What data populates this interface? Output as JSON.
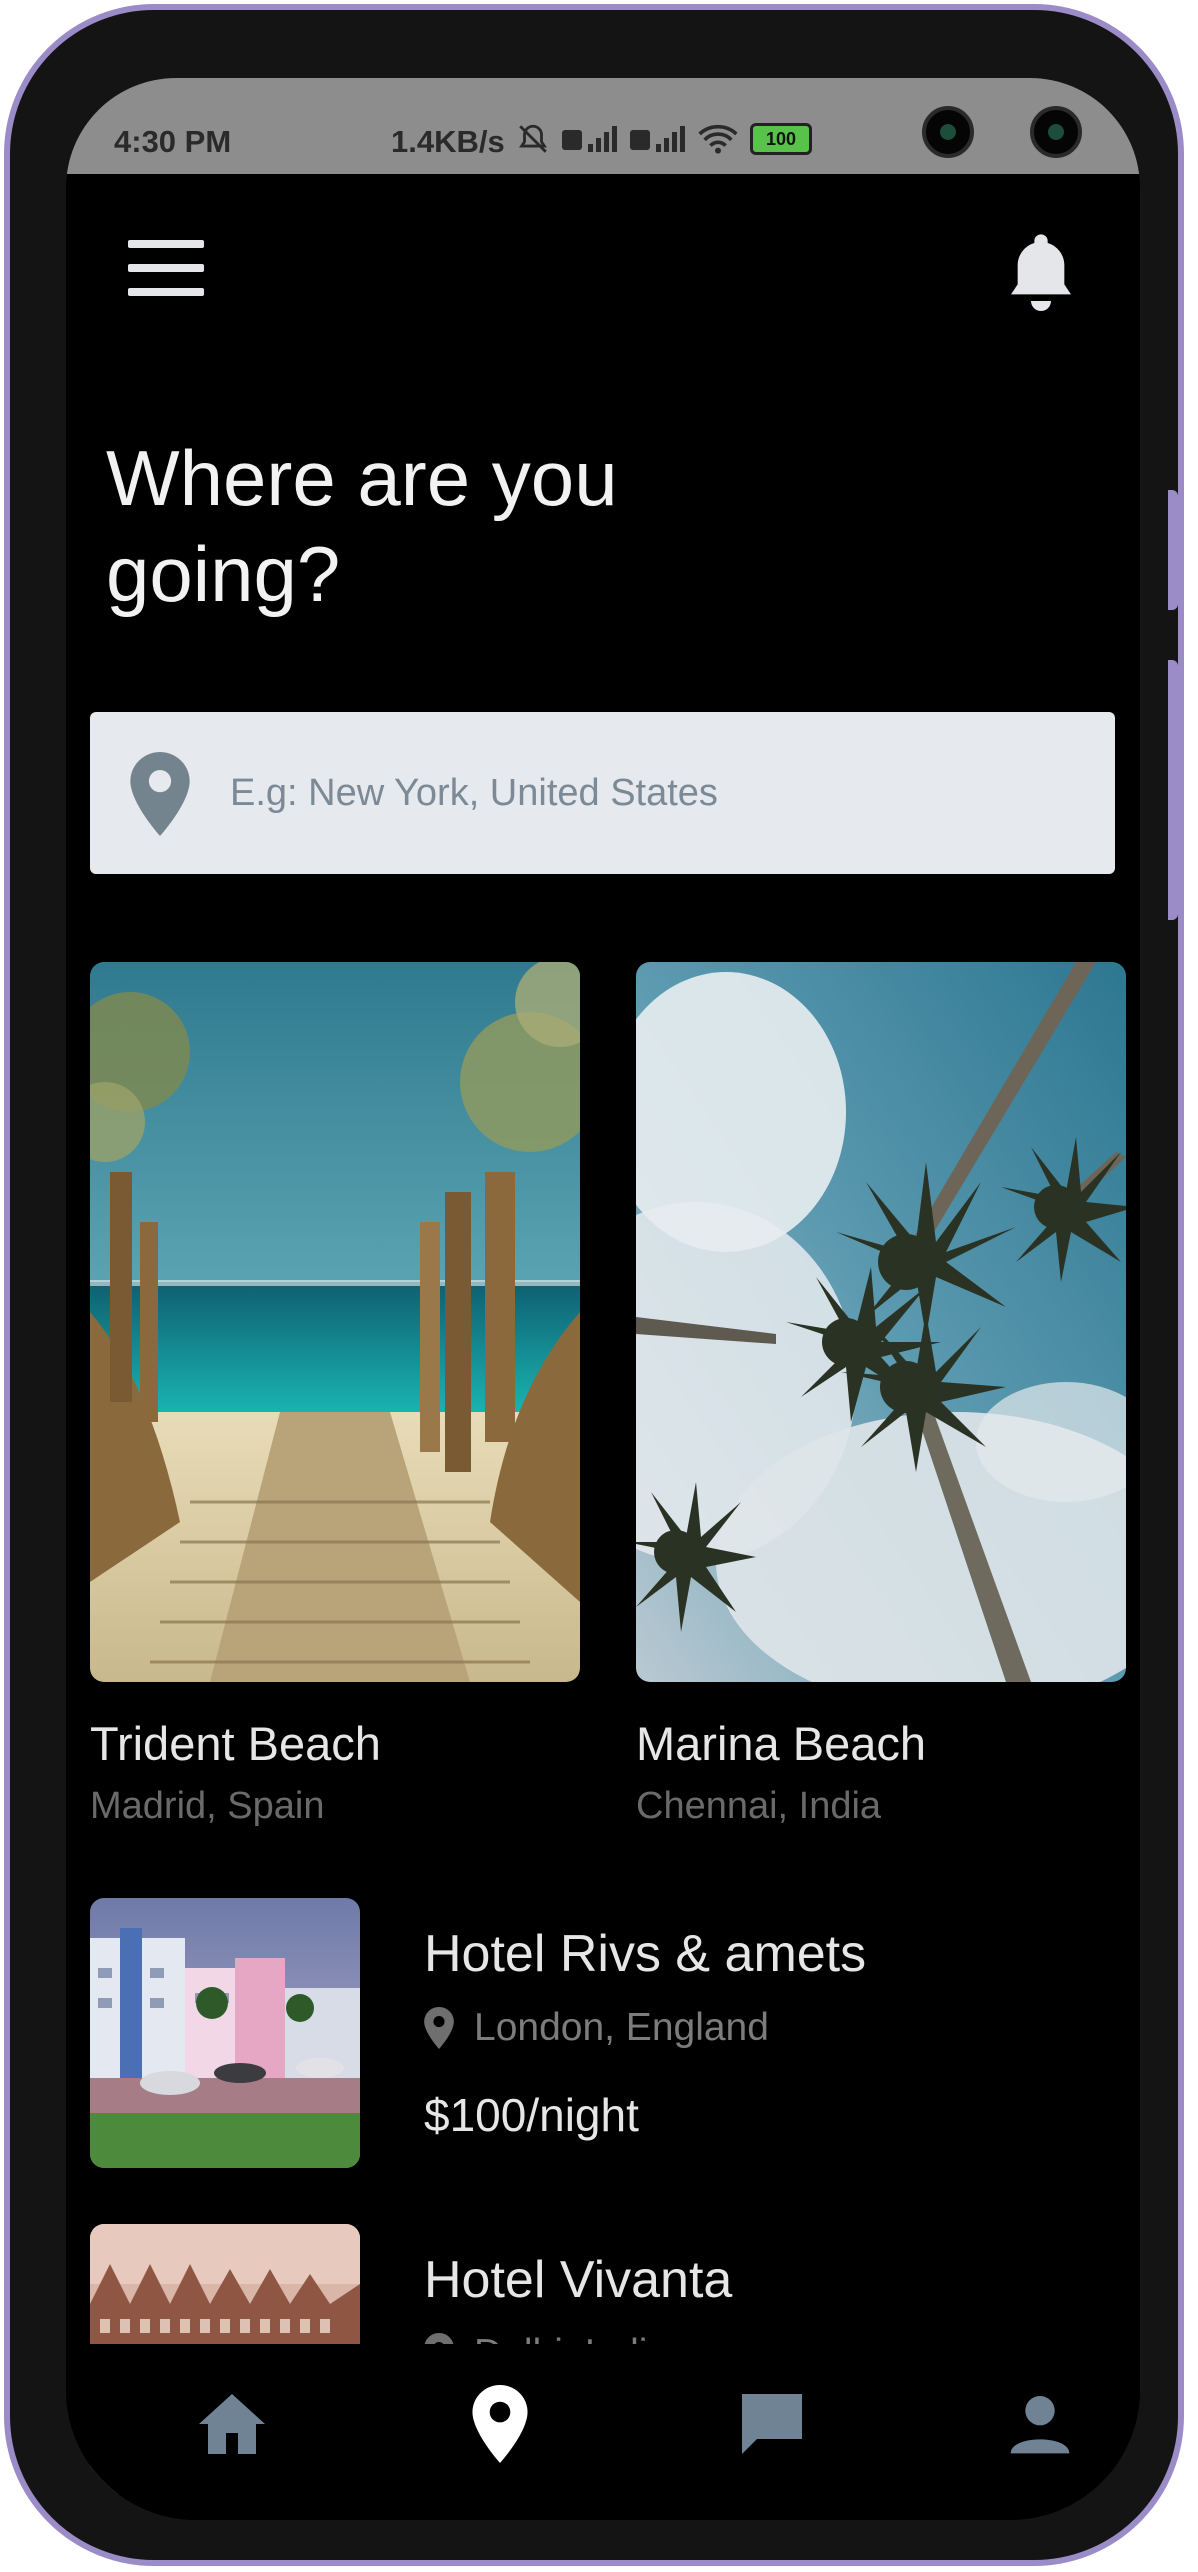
{
  "status_bar": {
    "time": "4:30 PM",
    "network_speed": "1.4KB/s",
    "battery": "100"
  },
  "header": {
    "menu_icon": "hamburger-icon",
    "notification_icon": "bell-icon"
  },
  "headline": {
    "line1": "Where are you",
    "line2": "going?"
  },
  "search": {
    "placeholder": "E.g: New York, United States",
    "icon": "location-pin-icon"
  },
  "featured": [
    {
      "title": "Trident Beach",
      "location": "Madrid, Spain"
    },
    {
      "title": "Marina Beach",
      "location": "Chennai, India"
    }
  ],
  "hotels": [
    {
      "name": "Hotel Rivs & amets",
      "location": "London, England",
      "price": "$100/night"
    },
    {
      "name": "Hotel Vivanta",
      "location": "Delhi, India",
      "price": ""
    }
  ],
  "bottom_nav": {
    "items": [
      {
        "icon": "home-icon",
        "active": false
      },
      {
        "icon": "location-pin-icon",
        "active": true
      },
      {
        "icon": "chat-icon",
        "active": false
      },
      {
        "icon": "profile-icon",
        "active": false
      }
    ],
    "colors": {
      "active": "#ffffff",
      "inactive": "#6f8394"
    }
  }
}
